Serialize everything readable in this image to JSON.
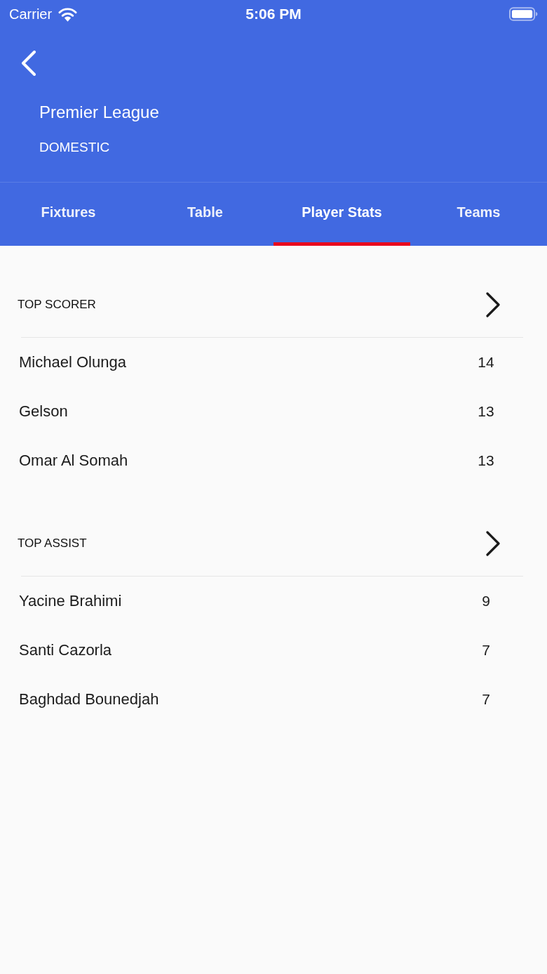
{
  "status_bar": {
    "carrier": "Carrier",
    "time": "5:06 PM"
  },
  "header": {
    "title": "Premier League",
    "subtitle": "DOMESTIC"
  },
  "tabs": [
    {
      "label": "Fixtures",
      "selected": false
    },
    {
      "label": "Table",
      "selected": false
    },
    {
      "label": "Player Stats",
      "selected": true
    },
    {
      "label": "Teams",
      "selected": false
    }
  ],
  "sections": [
    {
      "title": "TOP SCORER",
      "rows": [
        {
          "name": "Michael Olunga",
          "value": "14"
        },
        {
          "name": "Gelson",
          "value": "13"
        },
        {
          "name": "Omar Al Somah",
          "value": "13"
        }
      ]
    },
    {
      "title": "TOP ASSIST",
      "rows": [
        {
          "name": "Yacine Brahimi",
          "value": "9"
        },
        {
          "name": "Santi Cazorla",
          "value": "7"
        },
        {
          "name": "Baghdad Bounedjah",
          "value": "7"
        }
      ]
    }
  ]
}
